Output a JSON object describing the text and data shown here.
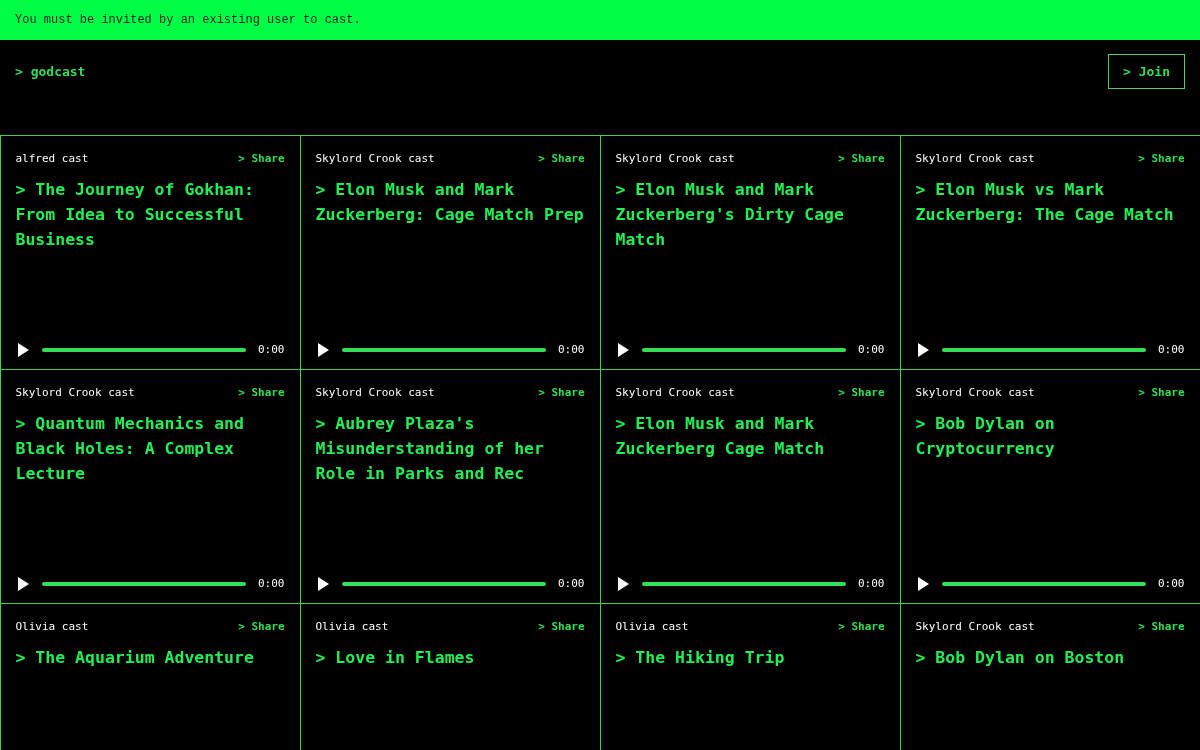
{
  "banner": {
    "text": "You must be invited by an existing user to cast."
  },
  "header": {
    "logo": "> godcast",
    "join_button": "> Join"
  },
  "casts": [
    {
      "author": "alfred cast",
      "share": "> Share",
      "title": "> The Journey of Gokhan: From Idea to Successful Business",
      "time": "0:00"
    },
    {
      "author": "Skylord Crook cast",
      "share": "> Share",
      "title": "> Elon Musk and Mark Zuckerberg: Cage Match Prep",
      "time": "0:00"
    },
    {
      "author": "Skylord Crook cast",
      "share": "> Share",
      "title": "> Elon Musk and Mark Zuckerberg's Dirty Cage Match",
      "time": "0:00"
    },
    {
      "author": "Skylord Crook cast",
      "share": "> Share",
      "title": "> Elon Musk vs Mark Zuckerberg: The Cage Match",
      "time": "0:00"
    },
    {
      "author": "Skylord Crook cast",
      "share": "> Share",
      "title": "> Quantum Mechanics and Black Holes: A Complex Lecture",
      "time": "0:00"
    },
    {
      "author": "Skylord Crook cast",
      "share": "> Share",
      "title": "> Aubrey Plaza's Misunderstanding of her Role in Parks and Rec",
      "time": "0:00"
    },
    {
      "author": "Skylord Crook cast",
      "share": "> Share",
      "title": "> Elon Musk and Mark Zuckerberg Cage Match",
      "time": "0:00"
    },
    {
      "author": "Skylord Crook cast",
      "share": "> Share",
      "title": "> Bob Dylan on Cryptocurrency",
      "time": "0:00"
    },
    {
      "author": "Olivia cast",
      "share": "> Share",
      "title": "> The Aquarium Adventure"
    },
    {
      "author": "Olivia cast",
      "share": "> Share",
      "title": "> Love in Flames"
    },
    {
      "author": "Olivia cast",
      "share": "> Share",
      "title": "> The Hiking Trip"
    },
    {
      "author": "Skylord Crook cast",
      "share": "> Share",
      "title": "> Bob Dylan on Boston"
    }
  ]
}
